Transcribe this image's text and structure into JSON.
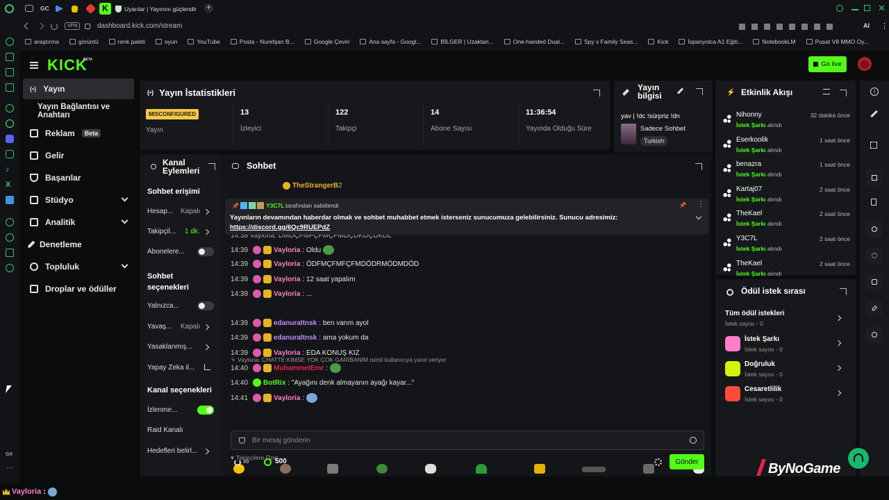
{
  "browser": {
    "tab_title": "Uyarılar | Yayınını güçlendir",
    "tab_short": "GC",
    "url": "dashboard.kick.com/stream",
    "vpn": "VPN",
    "ai": "AI",
    "bookmarks": [
      "araştırma",
      "görüntü",
      "renk paleti",
      "oyun",
      "YouTube",
      "Posta - Nurefşan B...",
      "Google Çeviri",
      "Ana sayfa - Googl...",
      "BİLGER | Uzaktan...",
      "One-handed Dual...",
      "Spy x Family Seas...",
      "Kick",
      "İspanyolca A1 Eğiti...",
      "NotebookLM",
      "Pusat V8 MMO Oy..."
    ],
    "rail_label": "GX"
  },
  "header": {
    "logo": "KICK",
    "logo_sup": "BETA",
    "go_live": "Go live"
  },
  "sidebar": {
    "items": [
      {
        "label": "Yayın"
      },
      {
        "label": "Yayın Bağlantısı ve Anahtarı"
      },
      {
        "label": "Reklam",
        "badge": "Beta"
      },
      {
        "label": "Gelir"
      },
      {
        "label": "Başarılar"
      },
      {
        "label": "Stüdyo"
      },
      {
        "label": "Analitik"
      },
      {
        "label": "Denetleme"
      },
      {
        "label": "Topluluk"
      },
      {
        "label": "Droplar ve ödüller"
      }
    ]
  },
  "stats": {
    "title": "Yayın İstatistikleri",
    "status_badge": "MISCONFIGURED",
    "status_label": "Yayın",
    "viewers": "13",
    "viewers_label": "İzleyici",
    "followers": "122",
    "followers_label": "Takipçi",
    "subs": "14",
    "subs_label": "Abone Sayısı",
    "uptime": "11:36:54",
    "uptime_label": "Yayında Olduğu Süre"
  },
  "stream_info": {
    "title": "Yayın bilgisi",
    "stream_title": "yav | !dc !sürpriz !dn",
    "category": "Sadece Sohbet",
    "language": "Turkish"
  },
  "channel_actions": {
    "title": "Kanal Eylemleri",
    "chat_access": "Sohbet erişimi",
    "rows": [
      {
        "label": "Hesap...",
        "value": "Kapalı"
      },
      {
        "label": "Takipçil...",
        "value": "1 dk."
      },
      {
        "label": "Abonelere..."
      }
    ],
    "chat_options": "Sohbet seçenekleri",
    "rows2": [
      {
        "label": "Yalnızca..."
      },
      {
        "label": "Yavaş...",
        "value": "Kapalı"
      },
      {
        "label": "Yasaklanmış..."
      },
      {
        "label": "Yapay Zeka il..."
      }
    ],
    "channel_options": "Kanal seçenekleri",
    "rows3": [
      {
        "label": "İzlenme..."
      },
      {
        "label": "Raid Kanalı"
      },
      {
        "label": "Hedefleri belirl..."
      }
    ]
  },
  "chat": {
    "title": "Sohbet",
    "top_user": "TheStrangerB",
    "top_count": "2",
    "pinned_by_user": "Y3C7L",
    "pinned_by_text": "tarafından sabitlendi",
    "pinned_msg": "Yayınların devamından haberdar olmak ve sohbet muhabbet etmek isterseniz sunucumuza gelebilirsiniz. Sunucu adresimiz:",
    "pinned_link": "https://discord.gg/6Qc9RUEPdZ",
    "partial_line": "14:38 Vayloria: DMDÇFMFÇFMÇFMDÇDKDÇDKDL",
    "messages": [
      {
        "time": "14:39",
        "user": "Vayloria",
        "text": ": Oldu"
      },
      {
        "time": "14:39",
        "user": "Vayloria",
        "text": ": ÖDFMÇFMFÇFMDÖDRMÖDMDÖD"
      },
      {
        "time": "14:39",
        "user": "Vayloria",
        "text": ": 12 saat yapalım"
      },
      {
        "time": "14:39",
        "user": "Vayloria",
        "text": ": ..."
      },
      {
        "time": "14:39",
        "user": "edanuraltnsk",
        "text": ": ben varım ayol"
      },
      {
        "time": "14:39",
        "user": "edanuraltnsk",
        "text": ": ama yokum da"
      },
      {
        "time": "14:39",
        "user": "Vayloria",
        "text": ": EDA KONUŞ KIZ"
      },
      {
        "time": "14:40",
        "user": "MuhammetEmr",
        "text": ":"
      },
      {
        "time": "14:40",
        "user": "BotRix",
        "text": ": \"Ayağını denk almayanın ayağı kayar...\""
      },
      {
        "time": "14:41",
        "user": "Vayloria",
        "text": ":"
      }
    ],
    "reply_note": "Vayloria: CHATTE KİMSE YOK ÇOK GARİBANIM isimli kullanıcıya yanıt veriyor",
    "followers_only": "Takipçilere Özel",
    "input_placeholder": "Bir mesaj gönderin",
    "points": "500",
    "infinity": "∞",
    "send": "Gönder"
  },
  "activity": {
    "title": "Etkinlik Akışı",
    "action": "İstek Şarkı",
    "action_suffix": "alındı",
    "events": [
      {
        "user": "Nihonny",
        "time": "32 dakika önce"
      },
      {
        "user": "Eserkoolik",
        "time": "1 saat önce"
      },
      {
        "user": "benazra",
        "time": "1 saat önce"
      },
      {
        "user": "Kartaj07",
        "time": "2 saat önce"
      },
      {
        "user": "TheKael",
        "time": "2 saat önce"
      },
      {
        "user": "Y3C7L",
        "time": "2 saat önce"
      },
      {
        "user": "TheKael",
        "time": "2 saat önce"
      }
    ]
  },
  "rewards": {
    "title": "Ödül istek sırası",
    "all": "Tüm ödül istekleri",
    "all_sub": "İstek sayısı - 0",
    "items": [
      {
        "name": "İstek Şarkı",
        "sub": "İstek sayısı - 0",
        "color": "#ff7ec8"
      },
      {
        "name": "Doğruluk",
        "sub": "İstek sayısı - 0",
        "color": "#d4f20a"
      },
      {
        "name": "Cesaretlilik",
        "sub": "İstek sayısı - 0",
        "color": "#ff4a3d"
      }
    ]
  },
  "watermark": "ByNoGame",
  "bottom": {
    "user": "Vayloria",
    "sep": ":"
  },
  "colors": {
    "accent": "#53fc18",
    "vayloria": "#ff7ec8",
    "muhammet": "#e8214a",
    "botrix": "#53fc18"
  }
}
